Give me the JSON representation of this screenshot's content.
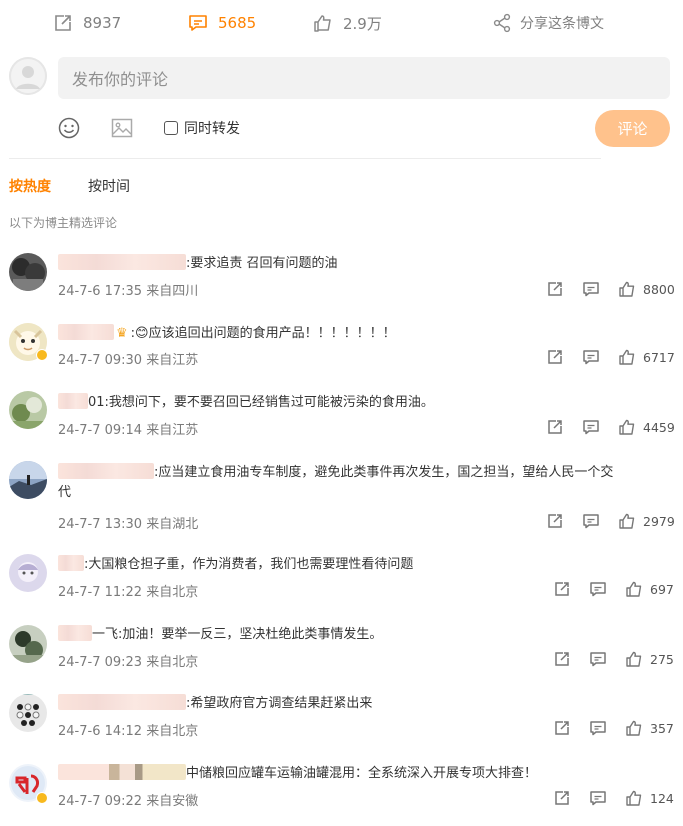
{
  "action_bar": {
    "repost_count": "8937",
    "comment_count": "5685",
    "like_count": "2.9万",
    "share_label": "分享这条博文",
    "accent": "#ff8200"
  },
  "composer": {
    "placeholder": "发布你的评论",
    "repost_label": "同时转发",
    "submit_label": "评论"
  },
  "sort": {
    "hot": "按热度",
    "time": "按时间"
  },
  "curated_label": "以下为博主精选评论",
  "comments": [
    {
      "name_suffix": "",
      "text": ":要求追责 召回有问题的油",
      "meta": "24-7-6 17:35 来自四川",
      "likes": "8800"
    },
    {
      "name_suffix": "",
      "text": ":😊应该追回出问题的食用产品！！！！！！！",
      "meta": "24-7-7 09:30 来自江苏",
      "likes": "6717"
    },
    {
      "name_suffix": "01",
      "text": ":我想问下，要不要召回已经销售过可能被污染的食用油。",
      "meta": "24-7-7 09:14 来自江苏",
      "likes": "4459"
    },
    {
      "name_suffix": "",
      "text": ":应当建立食用油专车制度，避免此类事件再次发生，国之担当，望给人民一个交",
      "text2": "代",
      "meta": "24-7-7 13:30 来自湖北",
      "likes": "2979"
    },
    {
      "name_suffix": "",
      "text": ":大国粮仓担子重，作为消费者，我们也需要理性看待问题",
      "meta": "24-7-7 11:22 来自北京",
      "likes": "697"
    },
    {
      "name_suffix": "一飞",
      "text": ":加油！要举一反三，坚决杜绝此类事情发生。",
      "meta": "24-7-7 09:23 来自北京",
      "likes": "275"
    },
    {
      "name_suffix": "",
      "text": ":希望政府官方调查结果赶紧出来",
      "meta": "24-7-6 14:12 来自北京",
      "likes": "357"
    },
    {
      "name_suffix": "",
      "text": "中储粮回应罐车运输油罐混用：全系统深入开展专项大排查！",
      "meta": "24-7-7 09:22 来自安徽",
      "likes": "124"
    }
  ],
  "icons": {
    "repost": "repost-icon",
    "comment": "comment-icon",
    "like": "thumbs-up-icon",
    "share": "share-icon",
    "emoji": "emoji-icon",
    "image": "image-icon"
  }
}
